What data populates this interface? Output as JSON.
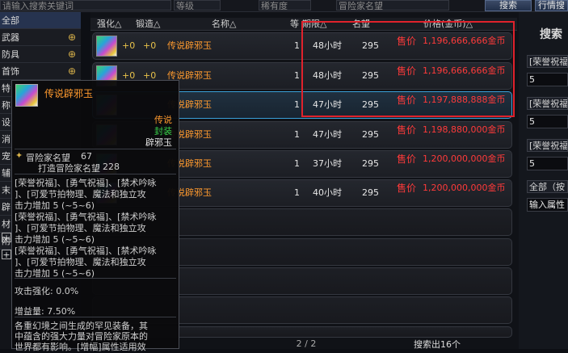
{
  "topbar": {
    "search_placeholder": "请输入搜索关键词",
    "level_label": "等级",
    "rarity_label": "稀有度",
    "fame_label": "冒险家名望",
    "search_button": "搜索",
    "browse_button": "行情搜"
  },
  "categories": [
    {
      "label": "全部",
      "has_icon": false
    },
    {
      "label": "武器",
      "has_icon": true
    },
    {
      "label": "防具",
      "has_icon": true
    },
    {
      "label": "首饰",
      "has_icon": true
    },
    {
      "label": "特",
      "has_icon": false
    },
    {
      "label": "称",
      "has_icon": false
    },
    {
      "label": "设",
      "has_icon": false
    },
    {
      "label": "消",
      "has_icon": false
    },
    {
      "label": "宠",
      "has_icon": false
    },
    {
      "label": "辅",
      "has_icon": false
    },
    {
      "label": "末",
      "has_icon": false
    },
    {
      "label": "辟",
      "has_icon": false
    },
    {
      "label": "材",
      "has_icon": false
    },
    {
      "label": "附",
      "has_icon": false
    }
  ],
  "columns": {
    "enhance": "强化△",
    "forge": "锻造△",
    "name": "名称△",
    "level": "等",
    "expire": "期限△",
    "fame": "名望",
    "price": "价格(金币)△"
  },
  "listings": [
    {
      "enhance": "+0",
      "forge": "+0",
      "name": "传说辟邪玉",
      "qty": "1",
      "time": "48小时",
      "fame": "295",
      "sell": "售价",
      "price": "1,196,666,666金币"
    },
    {
      "enhance": "+0",
      "forge": "+0",
      "name": "传说辟邪玉",
      "qty": "1",
      "time": "48小时",
      "fame": "295",
      "sell": "售价",
      "price": "1,196,666,666金币"
    },
    {
      "enhance": "",
      "forge": "",
      "name": "传说辟邪玉",
      "qty": "1",
      "time": "47小时",
      "fame": "295",
      "sell": "售价",
      "price": "1,197,888,888金币"
    },
    {
      "enhance": "",
      "forge": "",
      "name": "传说辟邪玉",
      "qty": "1",
      "time": "47小时",
      "fame": "295",
      "sell": "售价",
      "price": "1,198,880,000金币"
    },
    {
      "enhance": "",
      "forge": "",
      "name": "传说辟邪玉",
      "qty": "1",
      "time": "37小时",
      "fame": "295",
      "sell": "售价",
      "price": "1,200,000,000金币"
    },
    {
      "enhance": "",
      "forge": "",
      "name": "传说辟邪玉",
      "qty": "1",
      "time": "40小时",
      "fame": "295",
      "sell": "售价",
      "price": "1,200,000,000金币"
    }
  ],
  "right_panel": {
    "title": "搜索",
    "filters": [
      {
        "label": "[荣誉祝福",
        "value": "5"
      },
      {
        "label": "[荣誉祝福",
        "value": "5"
      },
      {
        "label": "[荣誉祝福",
        "value": "5"
      }
    ],
    "all_dropdown": "全部（按",
    "input_attr": "输入属性"
  },
  "tooltip": {
    "title": "传说辟邪玉",
    "rarity": "传说",
    "bind": "封装",
    "type": "辟邪玉",
    "fame_label": "冒险家名望",
    "fame_value": "67",
    "forge_fame_label": "打造冒险家名望",
    "forge_fame_value": "228",
    "lines": [
      "[荣誉祝福]、[勇气祝福]、[禁术吟咏",
      "]、[可爱节拍物理、魔法和独立攻",
      "击力增加 5 (~5~6)",
      "[荣誉祝福]、[勇气祝福]、[禁术吟咏",
      "]、[可爱节拍物理、魔法和独立攻",
      "击力增加 5 (~5~6)",
      "[荣誉祝福]、[勇气祝福]、[禁术吟咏",
      "]、[可爱节拍物理、魔法和独立攻",
      "击力增加 5 (~5~6)"
    ],
    "attack_enhance": "攻击强化: 0.0%",
    "gain": "增益量: 7.50%",
    "desc1": "各重幻境之间生成的罕见装备，其",
    "desc2": "中蕴含的强大力量对冒险家原本的",
    "desc3": "世界都有影响。[增幅]属性适用效"
  },
  "pager": "2 / 2",
  "result_count": "搜索出16个",
  "colors": {
    "accent_border": "#e0222c",
    "highlight_row": "#3aa0d8",
    "legendary": "#ff9a2e",
    "price": "#ff3a3a"
  }
}
